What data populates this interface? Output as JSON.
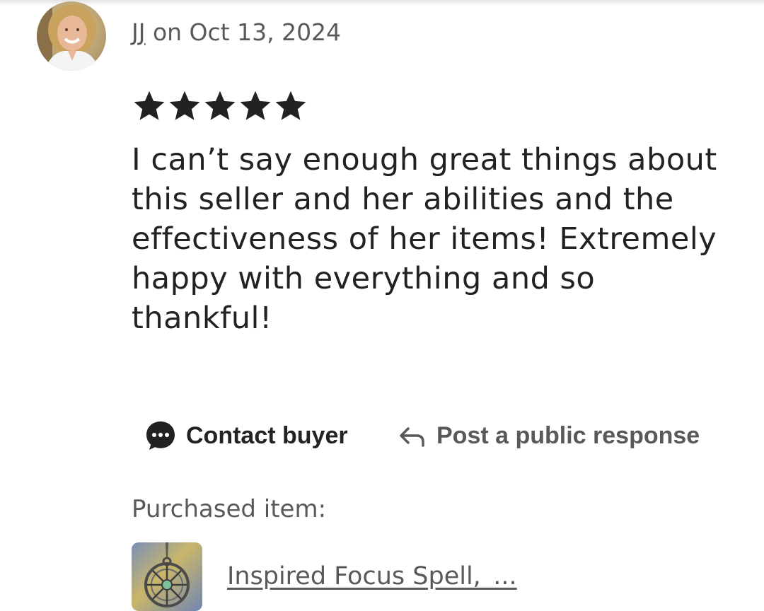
{
  "review": {
    "username": "JJ",
    "date_text": " on Oct 13, 2024",
    "rating": 5,
    "rating_max": 5,
    "text": "I can’t say enough great things about this seller and her abilities and the effectiveness of her items! Extremely happy with everything and so thankful!"
  },
  "actions": {
    "contact_label": "Contact buyer",
    "respond_label": "Post a public response"
  },
  "purchased": {
    "label": "Purchased item:",
    "item_title": "Inspired Focus Spell,_..."
  },
  "colors": {
    "text_primary": "#222222",
    "text_secondary": "#595959",
    "star": "#222222"
  },
  "icons": {
    "contact": "chat-bubble-icon",
    "respond": "reply-arrow-icon",
    "star": "star-icon"
  }
}
